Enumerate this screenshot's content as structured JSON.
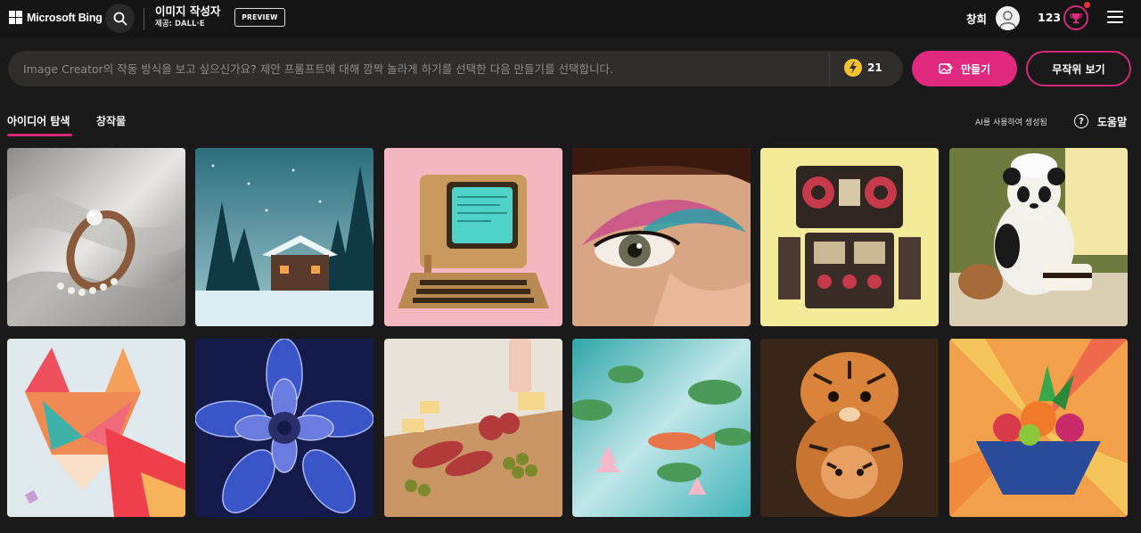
{
  "header": {
    "brand": "Microsoft Bing",
    "app_title": "이미지 작성자",
    "provider": "제공: DALL·E",
    "preview_badge": "PREVIEW",
    "username": "창희",
    "points": "123",
    "search_icon": "search-icon",
    "menu_icon": "hamburger-menu-icon",
    "trophy_icon": "trophy-icon"
  },
  "prompt": {
    "placeholder": "Image Creator의 작동 방식을 보고 싶으신가요? 제안 프롬프트에 대해 깜짝 놀라게 하기를 선택한 다음 만들기를 선택합니다.",
    "boosts": "21",
    "create_label": "만들기",
    "surprise_label": "무작위 보기"
  },
  "tabs": [
    {
      "label": "아이디어 탐색",
      "active": true
    },
    {
      "label": "창작물",
      "active": false
    }
  ],
  "ai_note": "AI를 사용하여 생성됨",
  "help_label": "도움말",
  "colors": {
    "accent": "#e0287f",
    "background": "#1b1a1a",
    "header": "#161515",
    "boost": "#f6c232"
  },
  "gallery": [
    {
      "subject": "pearl-ring"
    },
    {
      "subject": "snowy-cabin"
    },
    {
      "subject": "retro-computer"
    },
    {
      "subject": "eye-makeup"
    },
    {
      "subject": "boombox-robot"
    },
    {
      "subject": "panda-chef"
    },
    {
      "subject": "paper-fox"
    },
    {
      "subject": "blue-dahlia"
    },
    {
      "subject": "charcuterie-board"
    },
    {
      "subject": "koi-pond"
    },
    {
      "subject": "tiger-figurines"
    },
    {
      "subject": "fruit-bowl-art"
    }
  ]
}
